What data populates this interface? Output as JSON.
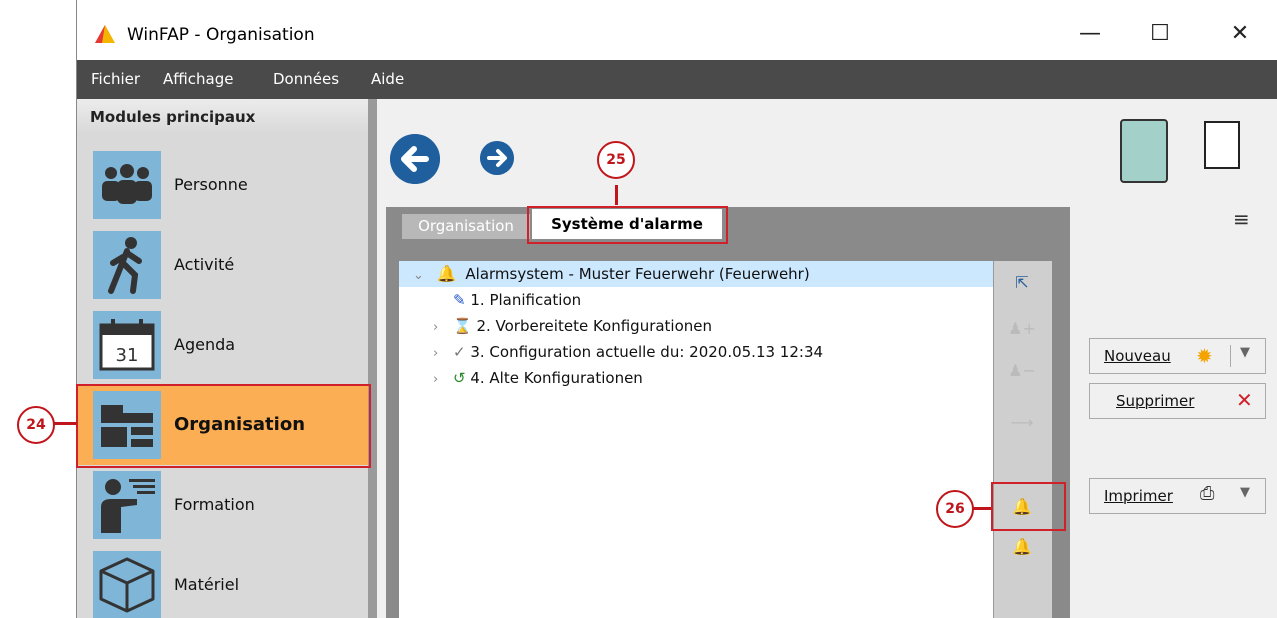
{
  "window": {
    "title": "WinFAP - Organisation",
    "minimize": "—",
    "maximize": "☐",
    "close": "✕"
  },
  "menu": [
    "Fichier",
    "Affichage",
    "Données",
    "Aide"
  ],
  "sidebar": {
    "header": "Modules principaux",
    "items": [
      {
        "label": "Personne",
        "icon": "people-icon"
      },
      {
        "label": "Activité",
        "icon": "walking-person-icon"
      },
      {
        "label": "Agenda",
        "icon": "calendar-icon",
        "icon_text": "31"
      },
      {
        "label": "Organisation",
        "icon": "folders-icon",
        "active": true
      },
      {
        "label": "Formation",
        "icon": "presenter-icon"
      },
      {
        "label": "Matériel",
        "icon": "box-icon"
      }
    ]
  },
  "tabs": [
    {
      "label": "Organisation",
      "active": false
    },
    {
      "label": "Système d'alarme",
      "active": true
    }
  ],
  "tree": {
    "root": "Alarmsystem - Muster Feuerwehr (Feuerwehr)",
    "children": [
      "1. Planification",
      "2. Vorbereitete Konfigurationen",
      "3. Configuration actuelle du: 2020.05.13 12:34",
      "4. Alte Konfigurationen"
    ]
  },
  "actions": {
    "new_label": "Nouveau",
    "delete_label": "Supprimer",
    "print_label": "Imprimer"
  },
  "callouts": [
    "24",
    "25",
    "26"
  ],
  "colors": {
    "accent": "#fbae53",
    "menubar": "#4a4a4a",
    "highlight": "#d0202a",
    "nav": "#1f5f9e"
  }
}
